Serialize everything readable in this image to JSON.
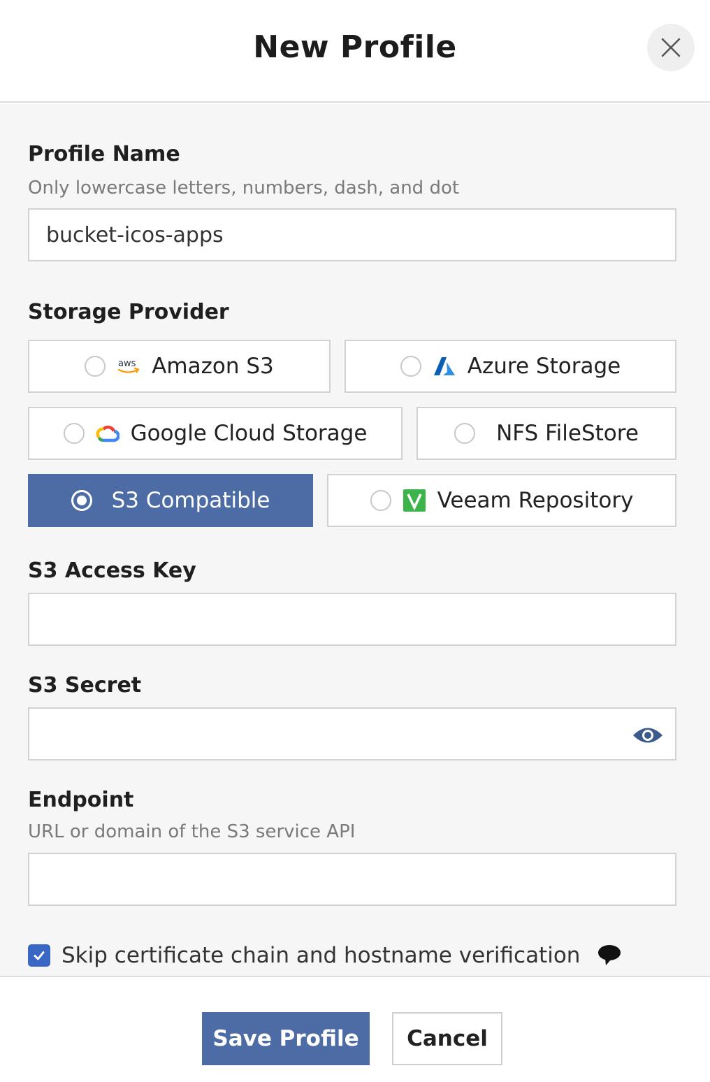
{
  "dialog": {
    "title": "New Profile"
  },
  "profile_name": {
    "label": "Profile Name",
    "help": "Only lowercase letters, numbers, dash, and dot",
    "value": "bucket-icos-apps"
  },
  "storage_provider": {
    "label": "Storage Provider",
    "options": [
      {
        "label": "Amazon S3",
        "icon": "aws-logo-icon",
        "selected": false
      },
      {
        "label": "Azure Storage",
        "icon": "azure-logo-icon",
        "selected": false
      },
      {
        "label": "Google Cloud Storage",
        "icon": "google-cloud-logo-icon",
        "selected": false
      },
      {
        "label": "NFS FileStore",
        "icon": "",
        "selected": false
      },
      {
        "label": "S3 Compatible",
        "icon": "",
        "selected": true
      },
      {
        "label": "Veeam Repository",
        "icon": "veeam-logo-icon",
        "selected": false
      }
    ],
    "aws_logo_text": "aws"
  },
  "s3_access_key": {
    "label": "S3 Access Key",
    "value": ""
  },
  "s3_secret": {
    "label": "S3 Secret",
    "value": ""
  },
  "endpoint": {
    "label": "Endpoint",
    "help": "URL or domain of the S3 service API",
    "value": ""
  },
  "skip_verification": {
    "label": "Skip certificate chain and hostname verification",
    "checked": true
  },
  "footer": {
    "save_label": "Save Profile",
    "cancel_label": "Cancel"
  },
  "colors": {
    "accent": "#4d6ca6",
    "checkbox": "#3a66c4",
    "veeam": "#3cb44a"
  }
}
